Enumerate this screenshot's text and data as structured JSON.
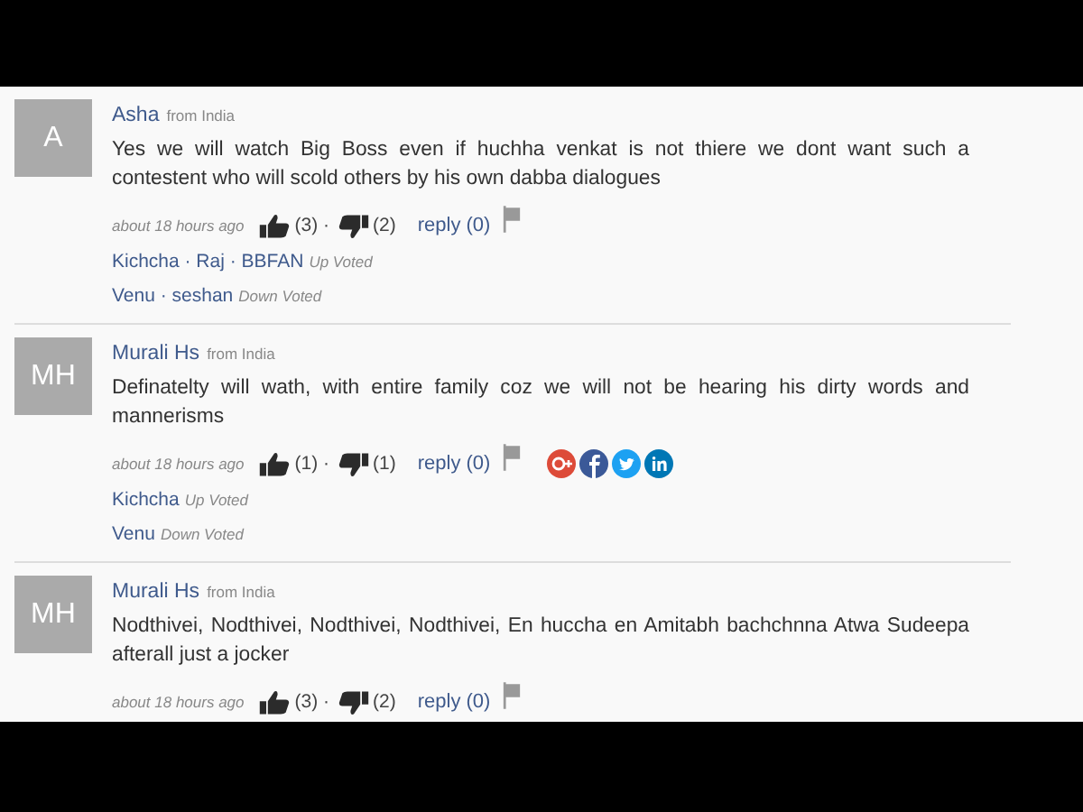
{
  "comments": [
    {
      "avatar": "A",
      "author": "Asha",
      "location": "from India",
      "text": "Yes we will watch Big Boss even if huchha venkat is not thiere we dont want such a contestent who will scold others by his own dabba dialogues",
      "time": "about 18 hours ago",
      "likes": "(3) ·",
      "dislikes": "(2)",
      "reply": "reply (0)",
      "share_icons": false,
      "voters": [
        {
          "names": "Kichcha · Raj · BBFAN",
          "label": "Up Voted"
        },
        {
          "names": "Venu · seshan",
          "label": "Down Voted"
        }
      ]
    },
    {
      "avatar": "MH",
      "author": "Murali Hs",
      "location": "from India",
      "text": "Definatelty will wath, with entire family coz we will not be hearing his dirty words and mannerisms",
      "time": "about 18 hours ago",
      "likes": "(1) ·",
      "dislikes": "(1)",
      "reply": "reply (0)",
      "share_icons": true,
      "voters": [
        {
          "names": "Kichcha",
          "label": "Up Voted"
        },
        {
          "names": "Venu",
          "label": "Down Voted"
        }
      ]
    },
    {
      "avatar": "MH",
      "author": "Murali Hs",
      "location": "from India",
      "text": "Nodthivei, Nodthivei, Nodthivei, Nodthivei, En huccha en Amitabh bachchnna Atwa Sudeepa afterall just a jocker",
      "time": "about 18 hours ago",
      "likes": "(3) ·",
      "dislikes": "(2)",
      "reply": "reply (0)",
      "share_icons": false
    }
  ]
}
